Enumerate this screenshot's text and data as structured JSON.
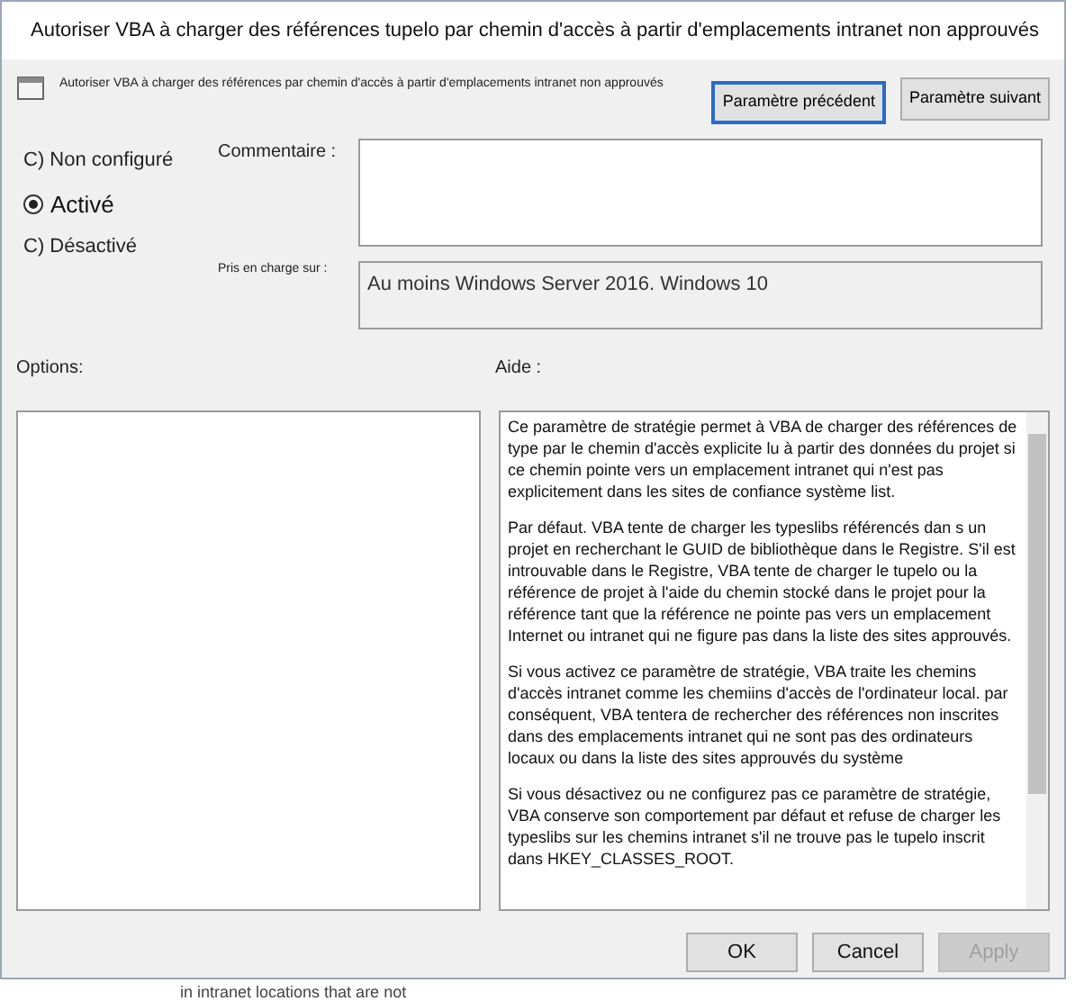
{
  "window": {
    "title": "Autoriser VBA à charger des références tupelo par chemin d'accès à partir d'emplacements intranet non approuvés"
  },
  "header": {
    "setting_name": "Autoriser VBA à charger des références par chemin d'accès à partir d'emplacements intranet non approuvés",
    "buttons": [
      {
        "label": "Paramètre précédent",
        "focused": true
      },
      {
        "label": "Paramètre suivant",
        "focused": false
      }
    ]
  },
  "state_options": [
    {
      "label": "C) Non configuré",
      "selected": false
    },
    {
      "label": "Activé",
      "selected": true
    },
    {
      "label": "C) Désactivé",
      "selected": false
    }
  ],
  "comment": {
    "label": "Commentaire :"
  },
  "supported_on": {
    "label": "Pris en charge sur :",
    "value": "Au moins Windows Server 2016. Windows 10"
  },
  "options": {
    "label": "Options:"
  },
  "help": {
    "label": "Aide :",
    "paragraphs": [
      "Ce paramètre de stratégie permet à VBA de charger des références de type par le chemin d'accès explicite lu à partir des données du projet si ce chemin pointe vers un emplacement intranet qui n'est pas explicitement dans les sites de confiance système list.",
      "Par défaut. VBA tente de charger les typeslibs référencés dan s un projet en recherchant le GUID de bibliothèque dans le Registre. S'il est introuvable dans le Registre, VBA tente de charger le tupelo ou la référence de projet à l'aide du chemin stocké dans le projet pour la référence tant que la référence ne pointe pas vers un emplacement Internet ou intranet qui ne figure pas dans la liste des sites approuvés.",
      "Si vous activez ce paramètre de stratégie, VBA traite les chemins d'accès intranet comme les chemiins d'accès de l'ordinateur local. par conséquent, VBA tentera de rechercher des références non inscrites dans des emplacements intranet qui ne sont pas des ordinateurs locaux ou dans la liste des sites approuvés du système",
      "Si vous désactivez ou ne configurez pas ce paramètre de stratégie, VBA conserve son comportement par défaut et refuse de charger les typeslibs sur les chemins intranet s'il ne trouve pas le tupelo inscrit dans HKEY_CLASSES_ROOT."
    ]
  },
  "footer_buttons": [
    {
      "label": "OK",
      "disabled": false
    },
    {
      "label": "Cancel",
      "disabled": false
    },
    {
      "label": "Apply",
      "disabled": true
    }
  ],
  "background_text": "in intranet locations that are not"
}
